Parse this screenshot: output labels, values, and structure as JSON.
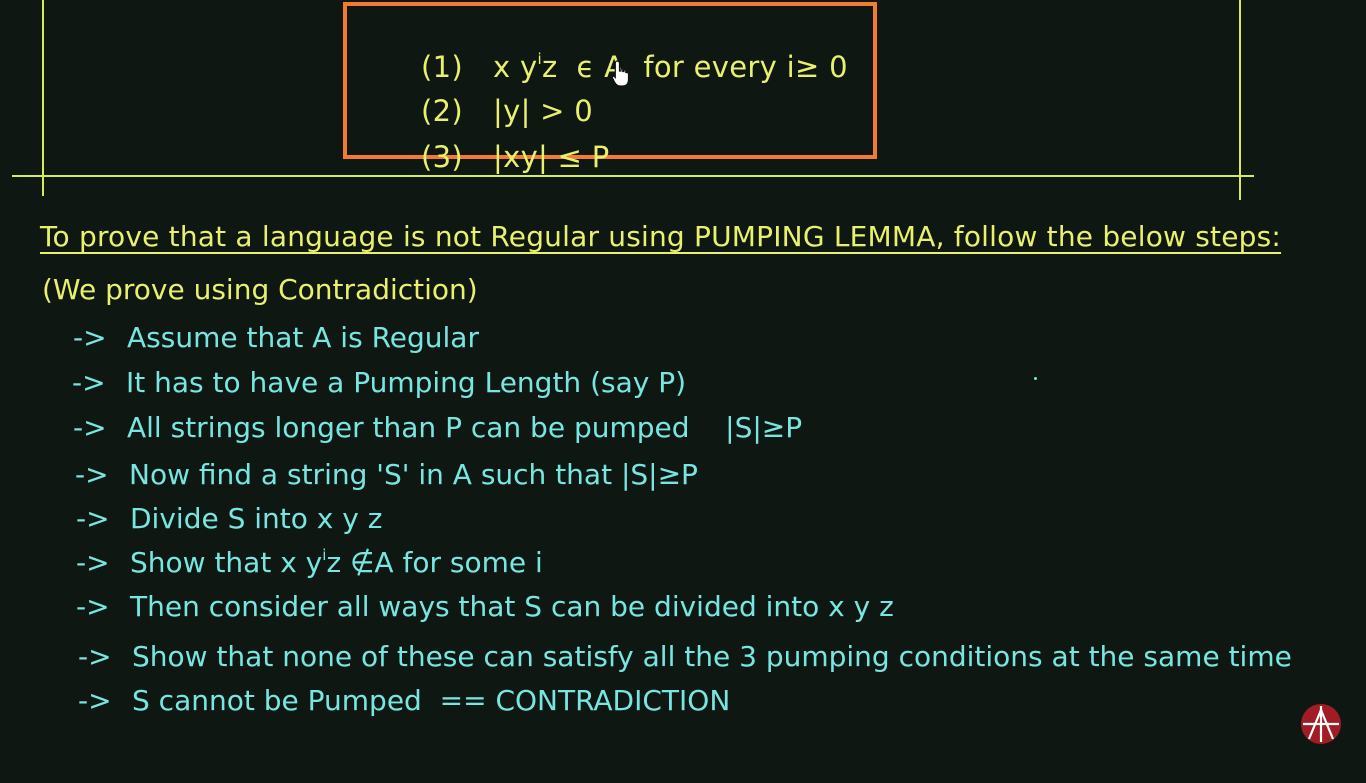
{
  "conditions": [
    {
      "num": "(1)",
      "pre": "x y",
      "sup": "i",
      "post": "z  ϵ A  for every i≥ 0"
    },
    {
      "num": "(2)",
      "pre": "|y| > 0",
      "sup": "",
      "post": ""
    },
    {
      "num": "(3)",
      "pre": "|xy| ≤ P",
      "sup": "",
      "post": ""
    }
  ],
  "heading": "To prove that a language is not Regular using PUMPING LEMMA, follow the below steps:",
  "subheading": "(We prove using Contradiction)",
  "arrow": "->",
  "steps": [
    {
      "pre": "Assume that A is Regular",
      "sup": "",
      "post": ""
    },
    {
      "pre": "It has to have a Pumping Length (say P)",
      "sup": "",
      "post": ""
    },
    {
      "pre": "All strings longer than P can be pumped    |S|≥P",
      "sup": "",
      "post": ""
    },
    {
      "pre": "Now find a string 'S' in A such that |S|≥P",
      "sup": "",
      "post": ""
    },
    {
      "pre": "Divide S into x y z",
      "sup": "",
      "post": ""
    },
    {
      "pre": "Show that x y",
      "sup": "i",
      "post": "z ∉A for some i"
    },
    {
      "pre": "Then consider all ways that S can be divided into x y z",
      "sup": "",
      "post": ""
    },
    {
      "pre": "Show that none of these can satisfy all the 3 pumping conditions at the same time",
      "sup": "",
      "post": ""
    },
    {
      "pre": "S cannot be Pumped  == CONTRADICTION",
      "sup": "",
      "post": ""
    }
  ],
  "colors": {
    "background": "#0f1713",
    "yellow_text": "#e8f06c",
    "cyan_text": "#78e6e0",
    "box_border": "#f27b2f",
    "lines": "#d6ec55"
  },
  "icons": {
    "cursor": "hand-pointer-icon",
    "logo": "channel-logo-icon"
  }
}
